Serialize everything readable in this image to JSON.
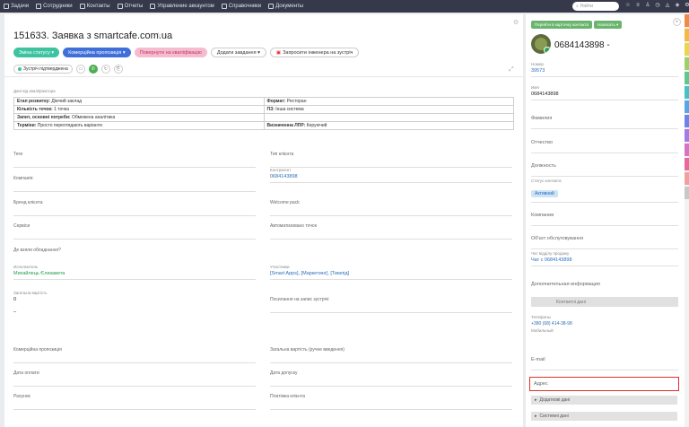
{
  "nav": [
    {
      "icon": "tasks-icon",
      "label": "Задачи"
    },
    {
      "icon": "users-icon",
      "label": "Сотрудники"
    },
    {
      "icon": "contacts-icon",
      "label": "Контакты"
    },
    {
      "icon": "reports-icon",
      "label": "Отчеты"
    },
    {
      "icon": "accounts-icon",
      "label": "Управление аккаунтом"
    },
    {
      "icon": "book-icon",
      "label": "Справочники"
    },
    {
      "icon": "docs-icon",
      "label": "Документы"
    }
  ],
  "search": {
    "placeholder": "Найти"
  },
  "deal": {
    "title": "151633. Заявка з smartcafe.com.ua",
    "buttons": {
      "change_status": "Зміна статусу ▾",
      "proposal": "Комерційна пропозиція ▾",
      "return_qual": "Повернути на кваліфікацію",
      "add_task": "Додати завдання ▾",
      "request_engineer": "Запросити інженера на зустріч"
    },
    "status_chip": "Зустріч підтверджена"
  },
  "qualification": {
    "label": "Дані від кваліфікатора",
    "rows": [
      [
        {
          "k": "Етап розвитку:",
          "v": " Діючий заклад"
        },
        {
          "k": "Формат:",
          "v": " Ресторан"
        }
      ],
      [
        {
          "k": "Кількість точок:",
          "v": " 1 точка"
        },
        {
          "k": "ПЗ:",
          "v": " Інша система"
        }
      ],
      [
        {
          "k": "Запит, основні потреби:",
          "v": " Обмежена аналітика"
        },
        {
          "k": "",
          "v": ""
        }
      ],
      [
        {
          "k": "Терміни:",
          "v": " Просто переглядають варіанти"
        },
        {
          "k": "Визначенна ЛПР:",
          "v": " Керуючий"
        }
      ]
    ]
  },
  "fields": {
    "tags": "Теги",
    "client_type": "Тип клієнта",
    "company": "Компанія:",
    "counterparty_label": "Контрагент",
    "counterparty": "0684143898",
    "brand": "Бренд клієнта",
    "welcome": "Welcome pack",
    "services": "Сервіси",
    "automated": "Автоматизовано точок",
    "equipment": "Де взяли обладнання?",
    "executor_label": "Исполнитель",
    "executor": "Михайлець Єлизавета",
    "participants_label": "Участники",
    "participants": "[Smart Apps], [Маркетинг], [Тимлід]",
    "total_label": "Загальна вартість",
    "total": "0",
    "dash": "–",
    "links": "Посилання на запис зустрічі",
    "commercial": "Комерційна пропозиція",
    "total_manual": "Загальна вартість (ручне введення)",
    "pay_date": "Дата оплати",
    "access_date": "Дата допуску",
    "invoice": "Рахунок",
    "platform": "Платіжка клієнта"
  },
  "sidebar": {
    "btn_card": "Перейти в карточку контакта",
    "btn_write": "Написать ▾",
    "phone": "0684143898 -",
    "number_label": "Номер",
    "number": "39573",
    "name_label": "Имя",
    "name": "0684143898",
    "surname": "Фамилия",
    "patronymic": "Отчество",
    "position": "Должность",
    "status_label": "Статус контакта",
    "status": "Активний",
    "companies": "Компании",
    "service_object": "Об'єкт обслуговування",
    "sale_chat_label": "Чат відділу продажу",
    "sale_chat": "Чат с 0684143898",
    "additional": "Дополнительная информация",
    "contact_data": "Контактні дані",
    "telephone_label": "Телефоны",
    "telephone": "+380 (68) 414-38-98",
    "mobile_label": "Мобильный",
    "email": "E-mail",
    "address": "Адрес",
    "extra_data": "Додаткові дані",
    "system_data": "Системні дані"
  },
  "strip_colors": [
    "#f08a4b",
    "#f5b942",
    "#e9d64a",
    "#9bd16a",
    "#5ec98f",
    "#47c1c6",
    "#58a6e6",
    "#6d83e8",
    "#a47ae6",
    "#d872c7",
    "#e9679a",
    "#f0a0a0",
    "#c8c8c8"
  ]
}
